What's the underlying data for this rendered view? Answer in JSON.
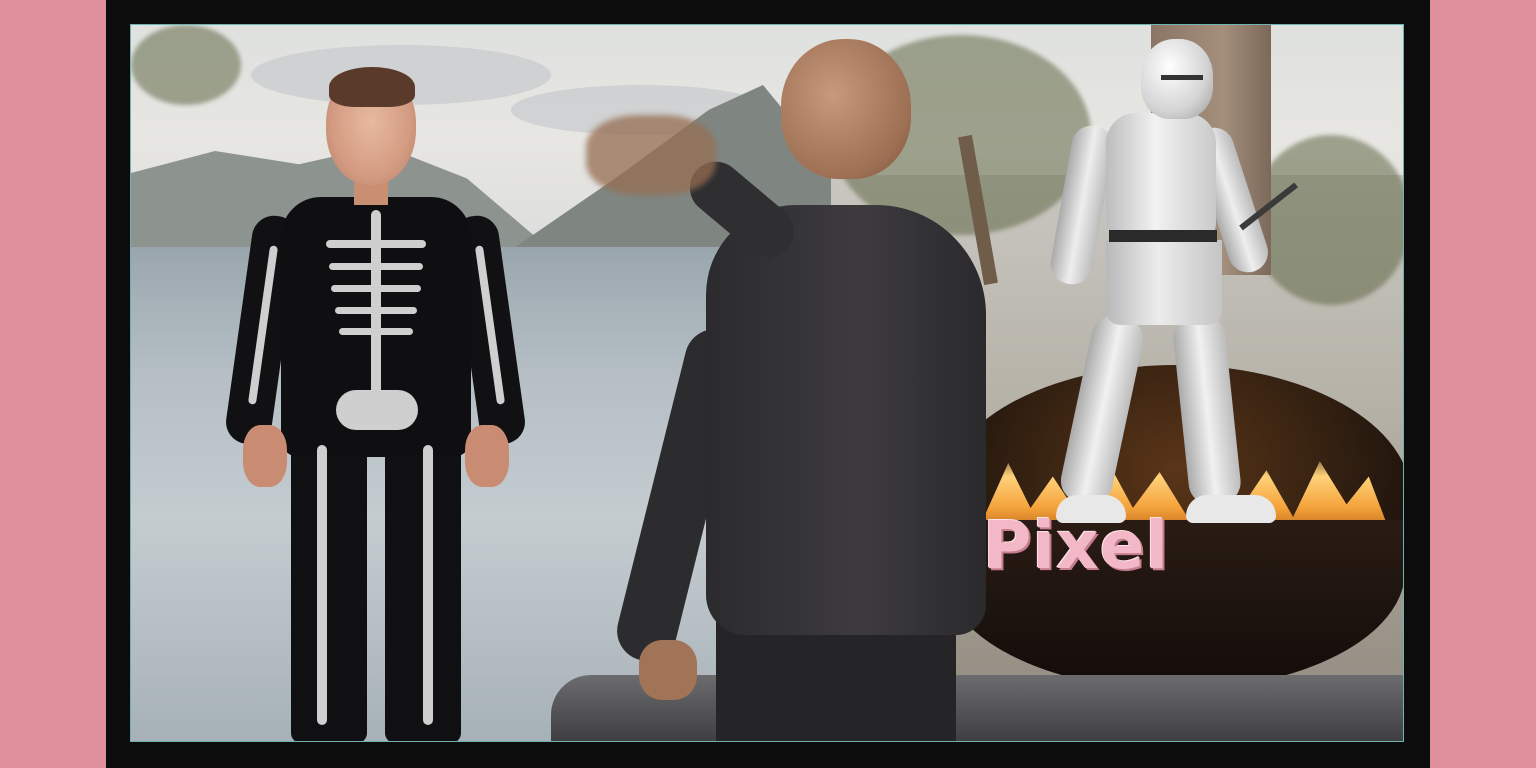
{
  "caption": {
    "text": "Pixel",
    "color": "#f2b8c7"
  },
  "colors": {
    "background": "#e0909c",
    "frame": "#0c0c0c",
    "frame_inner_border": "#6fb3b0"
  },
  "scene": {
    "subjects": [
      "avatar-skeleton-suit",
      "man-dark-sweater",
      "knight-armor",
      "fire-pit"
    ]
  }
}
